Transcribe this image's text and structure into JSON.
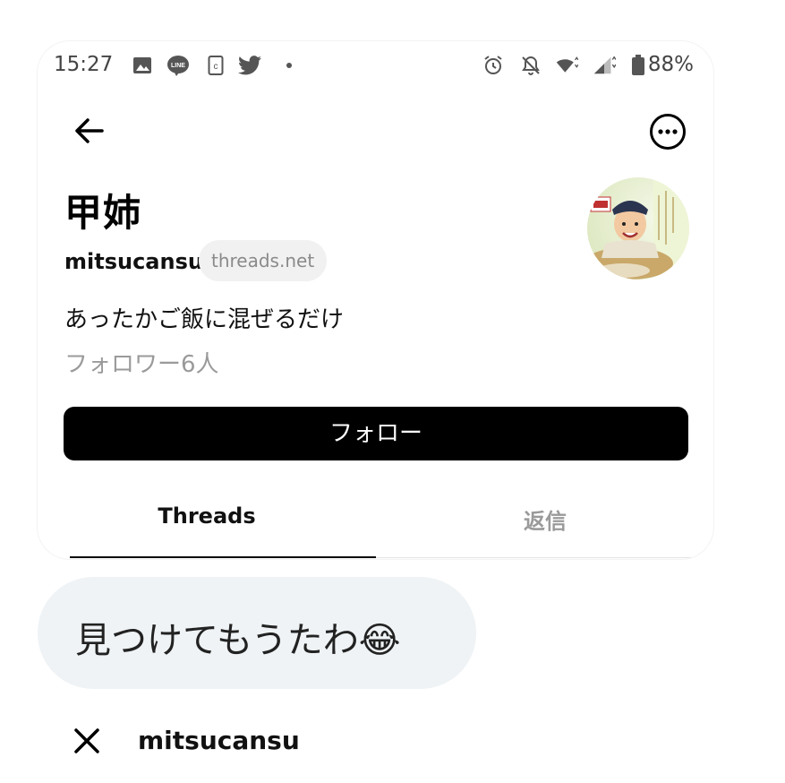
{
  "status_bar": {
    "time": "15:27",
    "battery": "88%",
    "icons": [
      "image-icon",
      "line-app-icon",
      "clipboard-icon",
      "twitter-icon",
      "dot-icon",
      "alarm-icon",
      "notifications-off-icon",
      "wifi-icon",
      "signal-icon",
      "battery-icon"
    ]
  },
  "header": {
    "back_icon": "arrow-left-icon",
    "more_icon": "more-horizontal-circle-icon"
  },
  "profile": {
    "name": "甲姉",
    "username": "mitsucansu",
    "domain_badge": "threads.net",
    "bio": "あったかご飯に混ぜるだけ",
    "followers": "フォロワー6人"
  },
  "follow_button": {
    "label": "フォロー"
  },
  "tabs": [
    {
      "label": "Threads",
      "active": true
    },
    {
      "label": "返信",
      "active": false
    }
  ],
  "comment": {
    "text": "見つけてもうたわ😂"
  },
  "bottom_bar": {
    "close_icon": "close-icon",
    "username": "mitsucansu"
  },
  "colors": {
    "button_bg": "#000000",
    "bubble_bg": "#eff3f5",
    "muted_text": "#9a9a9a",
    "badge_bg": "#f1f1f1"
  }
}
